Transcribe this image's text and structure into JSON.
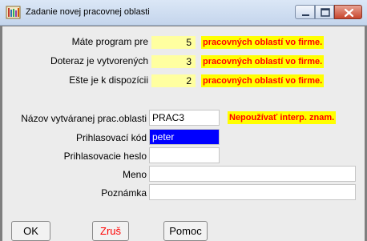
{
  "window": {
    "title": "Zadanie novej pracovnej oblasti",
    "icon": "app-icon"
  },
  "counts": [
    {
      "label": "Máte program pre",
      "value": "5",
      "note": "pracovných oblastí vo firme."
    },
    {
      "label": "Doteraz je vytvorených",
      "value": "3",
      "note": "pracovných oblastí vo firme."
    },
    {
      "label": "Ešte je k dispozícii",
      "value": "2",
      "note": "pracovných oblastí vo firme."
    }
  ],
  "form": {
    "name": {
      "label": "Názov vytváranej prac.oblasti",
      "value": "PRAC3",
      "warning": "Nepoužívať interp. znam."
    },
    "login_code": {
      "label": "Prihlasovací kód",
      "value": "peter"
    },
    "login_password": {
      "label": "Prihlasovacie heslo",
      "value": ""
    },
    "meno": {
      "label": "Meno",
      "value": ""
    },
    "poznamka": {
      "label": "Poznámka",
      "value": ""
    }
  },
  "buttons": {
    "ok": "OK",
    "cancel": "Zruš",
    "help": "Pomoc"
  },
  "colors": {
    "value_box": "#ffffa0",
    "highlight_bg": "#ffff00",
    "highlight_text": "#ff0000",
    "selection": "#0000ff"
  }
}
